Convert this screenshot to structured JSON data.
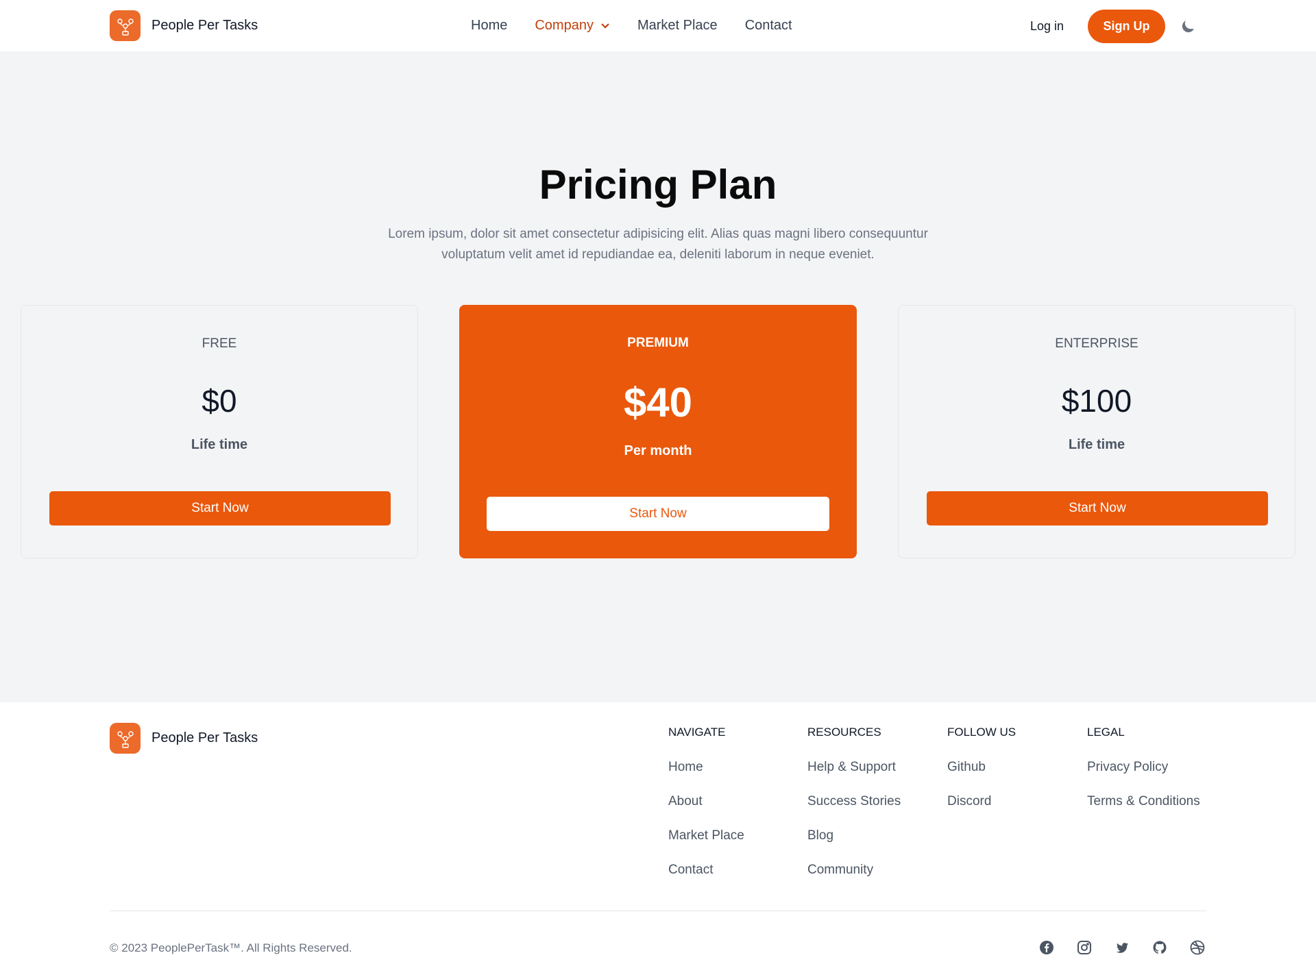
{
  "header": {
    "brand_name": "People Per Tasks",
    "nav": [
      "Home",
      "Company",
      "Market Place",
      "Contact"
    ],
    "login": "Log in",
    "signup": "Sign Up"
  },
  "hero": {
    "title": "Pricing Plan",
    "subtitle": "Lorem ipsum, dolor sit amet consectetur adipisicing elit. Alias quas magni libero consequuntur voluptatum velit amet id repudiandae ea, deleniti laborum in neque eveniet."
  },
  "plans": [
    {
      "name": "FREE",
      "price": "$0",
      "period": "Life time",
      "button": "Start Now"
    },
    {
      "name": "PREMIUM",
      "price": "$40",
      "period": "Per month",
      "button": "Start Now"
    },
    {
      "name": "ENTERPRISE",
      "price": "$100",
      "period": "Life time",
      "button": "Start Now"
    }
  ],
  "footer": {
    "brand_name": "People Per Tasks",
    "columns": [
      {
        "title": "NAVIGATE",
        "links": [
          "Home",
          "About",
          "Market Place",
          "Contact"
        ]
      },
      {
        "title": "RESOURCES",
        "links": [
          "Help & Support",
          "Success Stories",
          "Blog",
          "Community"
        ]
      },
      {
        "title": "FOLLOW US",
        "links": [
          "Github",
          "Discord"
        ]
      },
      {
        "title": "LEGAL",
        "links": [
          "Privacy Policy",
          "Terms & Conditions"
        ]
      }
    ],
    "copyright": "© 2023 PeoplePerTask™. All Rights Reserved.",
    "socials": [
      "facebook-icon",
      "instagram-icon",
      "twitter-icon",
      "github-icon",
      "dribbble-icon"
    ]
  },
  "colors": {
    "accent": "#ea580c",
    "background": "#f3f4f6"
  }
}
